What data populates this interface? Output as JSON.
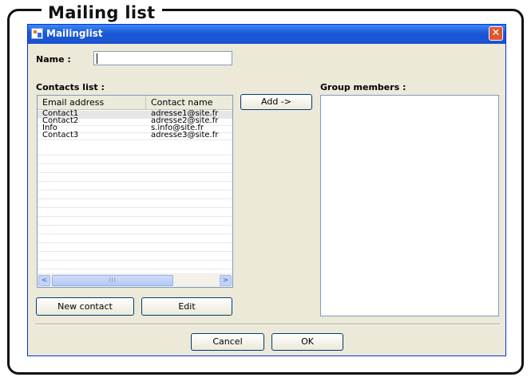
{
  "frame": {
    "title": "Mailing list"
  },
  "window": {
    "title": "Mailinglist",
    "close_glyph": "✕",
    "icon": "mailinglist-app-icon"
  },
  "form": {
    "name_label": "Name :",
    "name_value": "",
    "contacts_label": "Contacts list :",
    "members_label": "Group members :"
  },
  "contacts": {
    "headers": [
      "Email address",
      "Contact name"
    ],
    "rows": [
      [
        "Contact1",
        "adresse1@site.fr"
      ],
      [
        "Contact2",
        "adresse2@site.fr"
      ],
      [
        "Info",
        "s.info@site.fr"
      ],
      [
        "Contact3",
        "adresse3@site.fr"
      ]
    ],
    "selected_row": 0,
    "scroll": {
      "left_glyph": "<",
      "right_glyph": ">",
      "thumb_glyph": "III"
    }
  },
  "buttons": {
    "add": "Add ->",
    "new_contact": "New contact",
    "edit": "Edit",
    "cancel": "Cancel",
    "ok": "OK"
  },
  "group_members": []
}
